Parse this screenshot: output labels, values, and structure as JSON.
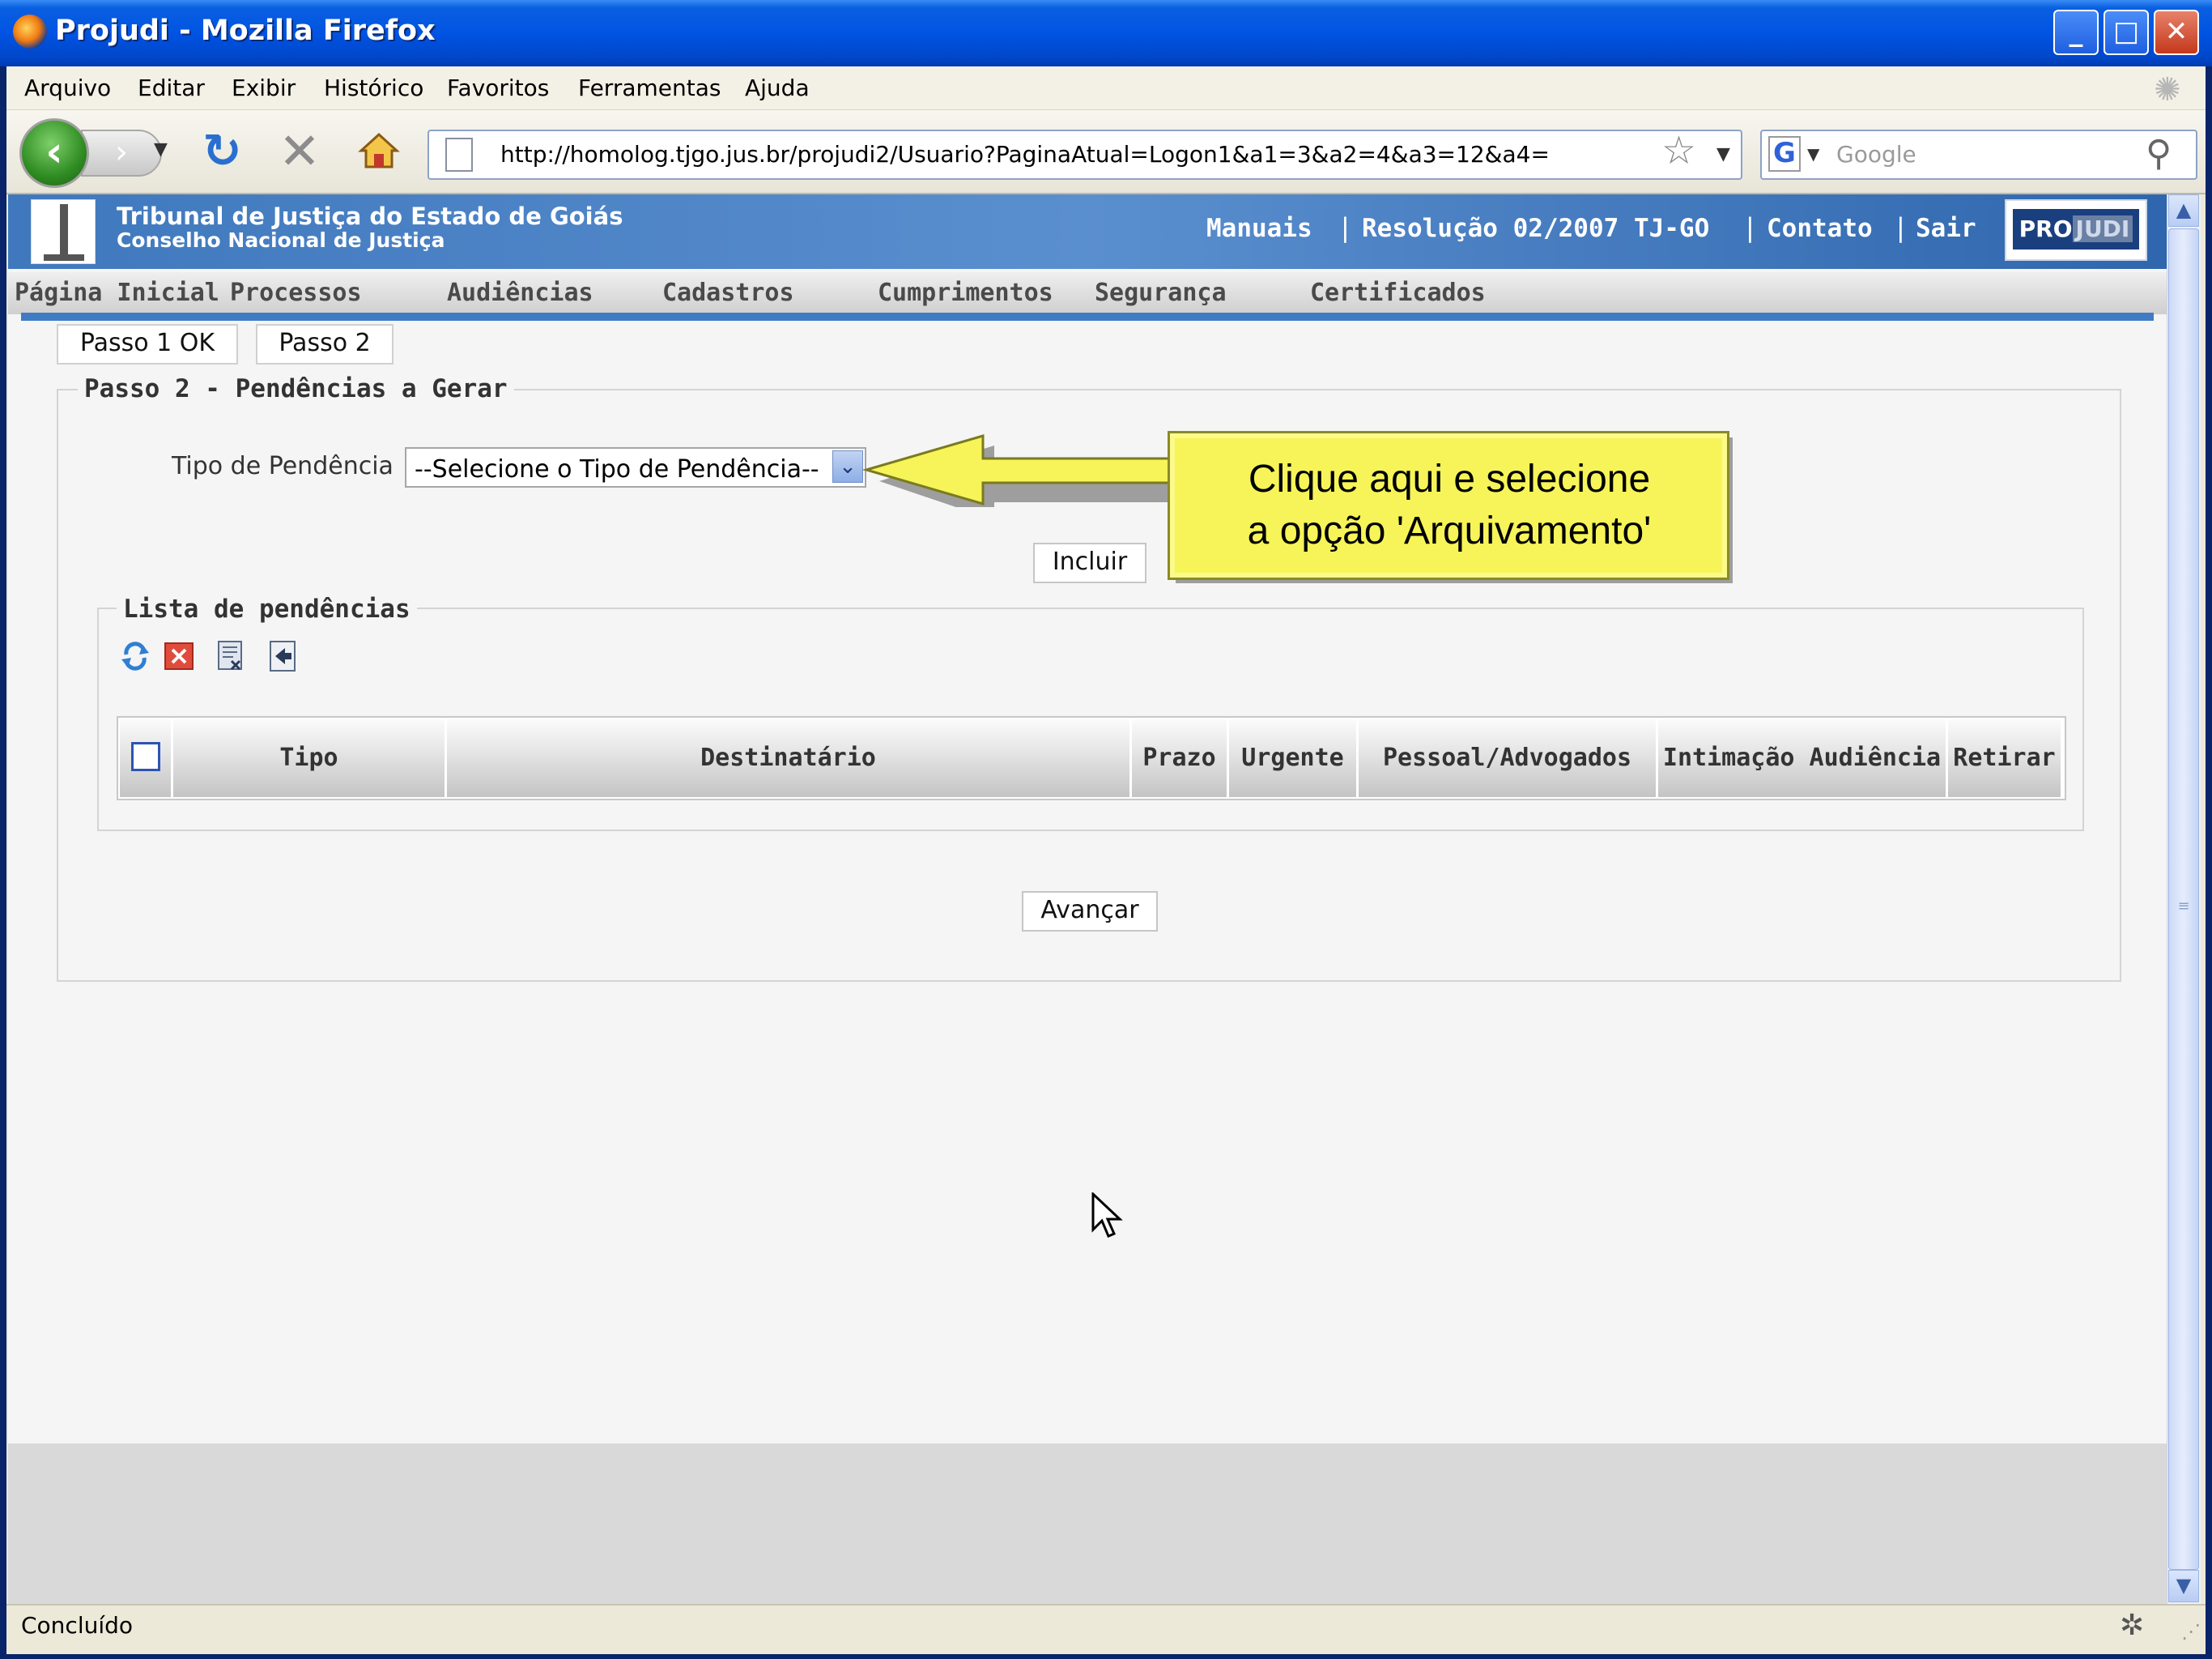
{
  "window": {
    "title": "Projudi - Mozilla Firefox",
    "minimize": "_",
    "maximize": "□",
    "close": "✕"
  },
  "menubar": [
    "Arquivo",
    "Editar",
    "Exibir",
    "Histórico",
    "Favoritos",
    "Ferramentas",
    "Ajuda"
  ],
  "toolbar": {
    "url": "http://homolog.tjgo.jus.br/projudi2/Usuario?PaginaAtual=Logon1&a1=3&a2=4&a3=12&a4=",
    "search_placeholder": "Google",
    "search_engine": "G"
  },
  "header": {
    "court": "Tribunal de Justiça do Estado de Goiás",
    "council": "Conselho Nacional de Justiça",
    "links": [
      "Manuais",
      "Resolução 02/2007 TJ-GO",
      "Contato",
      "Sair"
    ],
    "separator": "|",
    "logo_pro": "PRO",
    "logo_judi": "JUDI"
  },
  "nav_menu": [
    "Página Inicial",
    "Processos",
    "Audiências",
    "Cadastros",
    "Cumprimentos",
    "Segurança",
    "Certificados"
  ],
  "steps": {
    "tab1": "Passo 1 OK",
    "tab2": "Passo 2"
  },
  "form": {
    "legend": "Passo 2 - Pendências a Gerar",
    "tipo_label": "Tipo de Pendência",
    "tipo_selected": "--Selecione o Tipo de Pendência--",
    "incluir": "Incluir",
    "avancar": "Avançar"
  },
  "list": {
    "legend": "Lista de pendências",
    "icons": [
      "refresh-icon",
      "delete-icon",
      "clear-icon",
      "insert-icon"
    ],
    "columns": [
      "Tipo",
      "Destinatário",
      "Prazo",
      "Urgente",
      "Pessoal/Advogados",
      "Intimação Audiência",
      "Retirar"
    ],
    "rows": []
  },
  "callout": {
    "line1": "Clique aqui e selecione",
    "line2": "a opção 'Arquivamento'"
  },
  "statusbar": {
    "text": "Concluído"
  }
}
